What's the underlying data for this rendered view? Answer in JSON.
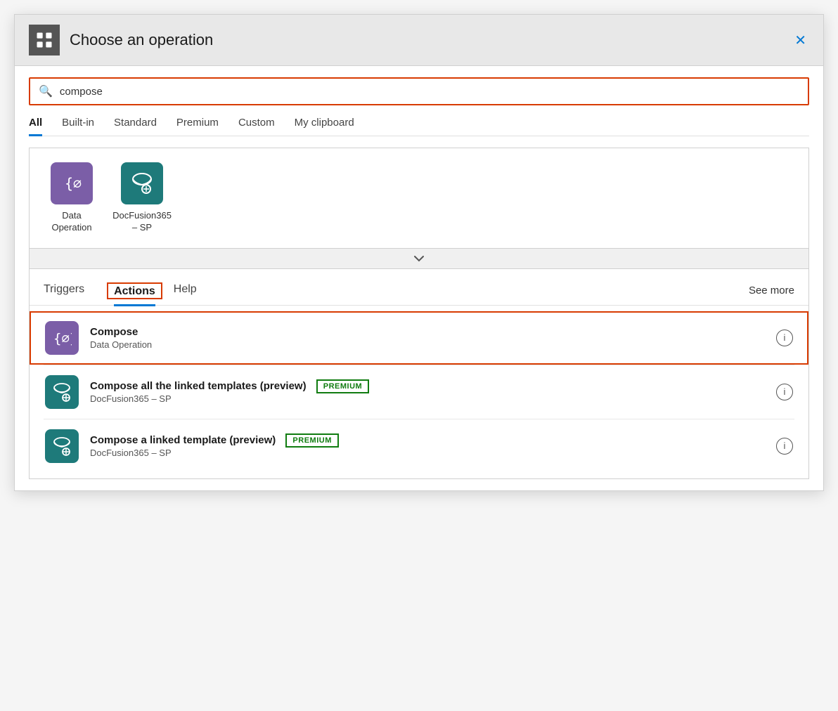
{
  "dialog": {
    "title": "Choose an operation",
    "close_label": "✕"
  },
  "search": {
    "value": "compose",
    "placeholder": "compose"
  },
  "filter_tabs": [
    {
      "id": "all",
      "label": "All",
      "active": true
    },
    {
      "id": "builtin",
      "label": "Built-in",
      "active": false
    },
    {
      "id": "standard",
      "label": "Standard",
      "active": false
    },
    {
      "id": "premium",
      "label": "Premium",
      "active": false
    },
    {
      "id": "custom",
      "label": "Custom",
      "active": false
    },
    {
      "id": "clipboard",
      "label": "My clipboard",
      "active": false
    }
  ],
  "connectors": [
    {
      "id": "data-operation",
      "label": "Data Operation",
      "icon_type": "purple"
    },
    {
      "id": "docfusion365-sp",
      "label": "DocFusion365 – SP",
      "icon_type": "teal"
    }
  ],
  "ops_tabs": [
    {
      "id": "triggers",
      "label": "Triggers",
      "active": false
    },
    {
      "id": "actions",
      "label": "Actions",
      "active": true
    },
    {
      "id": "help",
      "label": "Help",
      "active": false
    }
  ],
  "see_more_label": "See more",
  "operations": [
    {
      "id": "compose",
      "name": "Compose",
      "source": "Data Operation",
      "icon_type": "purple",
      "premium": false,
      "selected": true
    },
    {
      "id": "compose-all-linked",
      "name": "Compose all the linked templates (preview)",
      "source": "DocFusion365 – SP",
      "icon_type": "teal",
      "premium": true,
      "selected": false
    },
    {
      "id": "compose-linked-template",
      "name": "Compose a linked template (preview)",
      "source": "DocFusion365 – SP",
      "icon_type": "teal",
      "premium": true,
      "selected": false
    }
  ],
  "premium_badge_label": "PREMIUM",
  "icons": {
    "search": "🔍",
    "close": "✕",
    "chevron_down": "∨",
    "info": "i"
  }
}
